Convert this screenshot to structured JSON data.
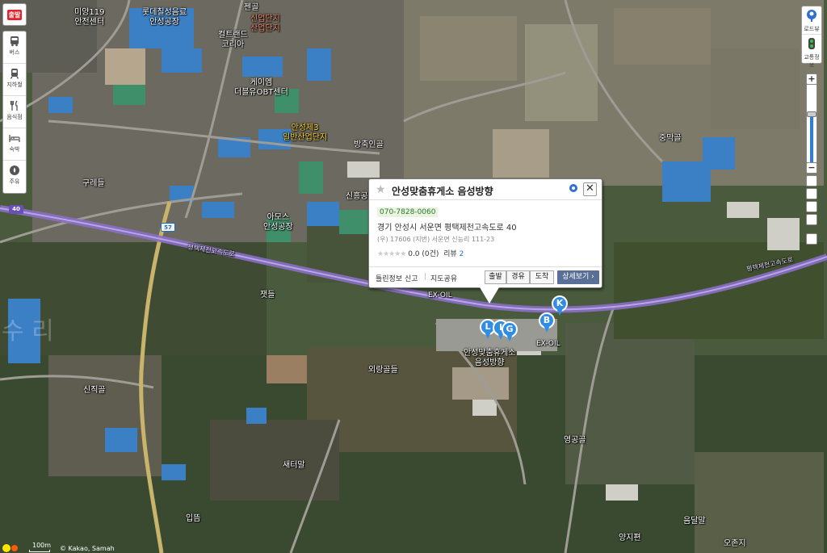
{
  "left_toolbar": {
    "depart": "출발",
    "categories": [
      {
        "label": "버스",
        "icon": "bus-icon"
      },
      {
        "label": "지하철",
        "icon": "subway-icon"
      },
      {
        "label": "음식점",
        "icon": "restaurant-icon"
      },
      {
        "label": "숙박",
        "icon": "bed-icon"
      },
      {
        "label": "주유",
        "icon": "gas-icon"
      }
    ]
  },
  "right_toolbar": {
    "view_items": [
      {
        "label": "로드뷰",
        "icon": "roadview-icon"
      },
      {
        "label": "교통정보",
        "icon": "traffic-icon"
      }
    ],
    "zoom_in": "+",
    "zoom_out": "−",
    "zoom_level_fraction": 0.62
  },
  "popup": {
    "title": "안성맞춤휴게소 음성방향",
    "phone": "070-7828-0060",
    "address": "경기 안성시 서운면 평택제천고속도로 40",
    "address_sub": "(우) 17606  (지번) 서운면 신능리 111-23",
    "rating_stars": "★★★★★",
    "rating_text": "0.0 (0건)",
    "review_label": "리뷰",
    "review_count": "2",
    "report_link": "틀린정보 신고",
    "share_link": "지도공유",
    "btn_depart": "출발",
    "btn_via": "경유",
    "btn_arrive": "도착",
    "btn_detail": "상세보기 ›",
    "close": "✕"
  },
  "markers": [
    {
      "letter": "K"
    },
    {
      "letter": "B"
    },
    {
      "letter": "L"
    },
    {
      "letter": "I"
    },
    {
      "letter": "G"
    }
  ],
  "road_badges": {
    "expressway": "40",
    "national": "57"
  },
  "place_labels": {
    "firestation": "미양119\n안전센터",
    "lotte": "롯데칠성음료\n안성공장",
    "jeongol": "젠골",
    "industrial_top": "신업단지\n산업단지",
    "cultlelandcore": "컬트랜드\n코리아",
    "jaeil": "케이엠\n더블유OBT센터",
    "ansung3": "안성제3\n일반산업단지",
    "bangchuk": "방축인골",
    "gurye": "구레들",
    "sinheung": "신흥공",
    "amos": "아모스\n안성공장",
    "jungmak": "중막골",
    "expressway_left": "평택제천고속도로",
    "expressway_right": "평택제천고속도로",
    "exoil_top": "EX-OIL",
    "exoil_right": "EX-OIL",
    "rest_area": "안성맞춤휴게소\n음성방향",
    "jaetdeul": "잿들",
    "oeranggol": "외랑골들",
    "sinjik": "신직골",
    "saetmal": "새터말",
    "ipgu": "입뜸",
    "yeonggongol": "영공골",
    "eumdalmal": "음달말",
    "yangjibeon": "양지편",
    "ojunji": "오존지",
    "ghost": "수 리"
  },
  "scale": "100m",
  "copyright": "© Kakao, Samah"
}
